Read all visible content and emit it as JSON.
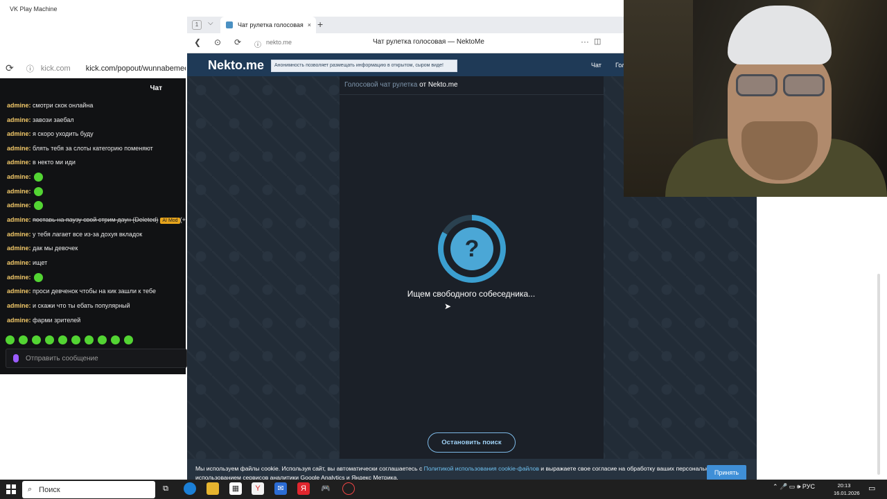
{
  "app": {
    "label": "VK Play Machine"
  },
  "chat": {
    "refresh_icon": "⟳",
    "shield_icon": "ⓘ",
    "domain": "kick.com",
    "url": "kick.com/popout/wunnabemee/ch",
    "header": "Чат",
    "messages": [
      {
        "user": "admine:",
        "text": "смотри скок онлайна"
      },
      {
        "user": "admine:",
        "text": "завози заебал"
      },
      {
        "user": "admine:",
        "text": "я скоро уходить буду"
      },
      {
        "user": "admine:",
        "text": "блять тебя за слоты категорию поменяют"
      },
      {
        "user": "admine:",
        "text": "в некто ми иди"
      },
      {
        "user": "admine:",
        "text": ""
      },
      {
        "user": "admine:",
        "text": ""
      },
      {
        "user": "admine:",
        "text": ""
      },
      {
        "user": "admine:",
        "text": "поставь на паузу свой стрим даун (Deleted)",
        "badge": "AI Mod",
        "extra": "(+"
      },
      {
        "user": "admine:",
        "text": "у тебя лагает все из-за дохуя вкладок"
      },
      {
        "user": "admine:",
        "text": "дак мы девочек"
      },
      {
        "user": "admine:",
        "text": "ищет"
      },
      {
        "user": "admine:",
        "text": ""
      },
      {
        "user": "admine:",
        "text": "проси девченок чтобы на кик зашли к тебе"
      },
      {
        "user": "admine:",
        "text": "и скажи что ты ебать популярный"
      },
      {
        "user": "admine:",
        "text": "фарми зрителей"
      }
    ],
    "input_placeholder": "Отправить сообщение"
  },
  "browser": {
    "tab_count": "1",
    "tab_title": "Чат рулетка голосовая",
    "tab_close": "×",
    "new_tab": "+",
    "back": "❮",
    "domain": "nekto.me",
    "page_title": "Чат рулетка голосовая — NektoMe",
    "more": "···"
  },
  "site": {
    "logo": "Nekto.me",
    "notice": "Анонимность позволяет размещать информацию в открытом, сыром виде!",
    "nav": [
      "Чат",
      "Голосовой"
    ],
    "crumb_part1": "Голосовой чат рулетка",
    "crumb_part2": " от Nekto.me",
    "loader_symbol": "?",
    "status": "Ищем свободного собеседника...",
    "stop_button": "Остановить поиск"
  },
  "cookie": {
    "text_1": "Мы используем файлы cookie. Используя сайт, вы автоматически соглашаетесь с ",
    "link": "Политикой использования cookie-файлов",
    "text_2": " и выражаете свое согласие на обработку вашиx персональных данных с использованием сервисов аналитики Google Analytics и Яндекс Метрика.",
    "accept": "Принять"
  },
  "taskbar": {
    "search": "Поиск",
    "tray": "⌃  🎤  ▭  🕪  РУС",
    "time": "20:13",
    "date": "16.01.2026"
  },
  "colors": {
    "accent": "#3f8fd7",
    "username": "#f3c969",
    "page_bg": "#222c37"
  }
}
